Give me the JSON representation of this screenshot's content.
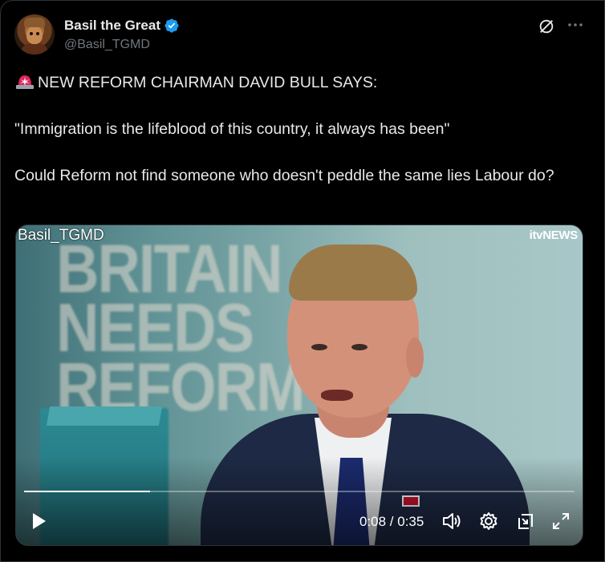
{
  "author": {
    "display_name": "Basil the Great",
    "handle": "@Basil_TGMD",
    "verified": true
  },
  "tweet": {
    "line1": "NEW REFORM CHAIRMAN DAVID BULL SAYS:",
    "line2": "\"Immigration is the lifeblood of this country, it always has been\"",
    "line3": "Could Reform not find someone who doesn't peddle the same lies Labour do?"
  },
  "video": {
    "watermark": "Basil_TGMD",
    "channel_logo": "itvNEWS",
    "backdrop_lines": [
      "BRITAIN",
      "NEEDS",
      "REFORM"
    ],
    "current_time": "0:08",
    "duration": "0:35",
    "time_display": "0:08 / 0:35",
    "progress_fraction": 0.2286
  },
  "icons": {
    "verified": "verified-badge-icon",
    "grok": "grok-icon",
    "more": "more-icon",
    "siren": "siren-emoji-icon",
    "play": "play-icon",
    "volume": "volume-icon",
    "settings": "gear-icon",
    "pip": "picture-in-picture-icon",
    "fullscreen": "fullscreen-icon"
  },
  "colors": {
    "background": "#000000",
    "text": "#e7e9ea",
    "secondary_text": "#71767b",
    "verified_blue": "#1d9bf0",
    "siren_red": "#e0245e"
  }
}
